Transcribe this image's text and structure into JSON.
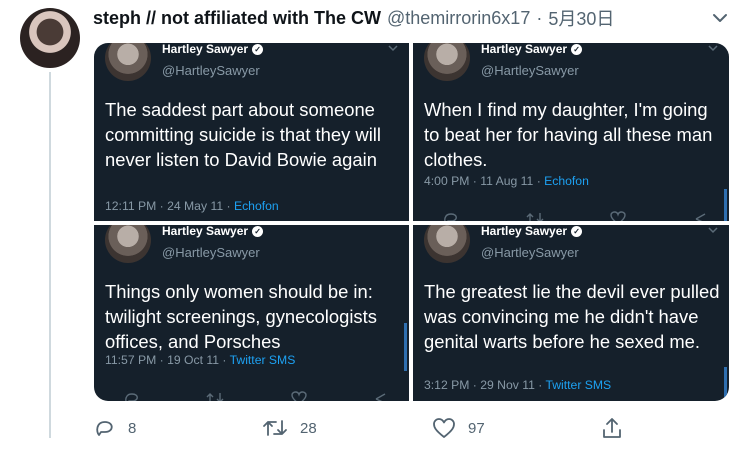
{
  "tweet": {
    "author_name": "steph // not affiliated with The CW",
    "author_handle": "@themirrorin6x17",
    "separator": "·",
    "date": "5月30日"
  },
  "embeds": [
    {
      "name": "Hartley Sawyer",
      "handle": "@HartleySawyer",
      "text": "The saddest part about someone committing suicide is that they will never listen to David Bowie again",
      "time": "12:11 PM · 24 May 11 · ",
      "source": "Echofon"
    },
    {
      "name": "Hartley Sawyer",
      "handle": "@HartleySawyer",
      "text": "When I find my daughter, I'm going to beat her for having all these man clothes.",
      "time": "4:00 PM · 11 Aug 11 · ",
      "source": "Echofon"
    },
    {
      "name": "Hartley Sawyer",
      "handle": "@HartleySawyer",
      "text": "Things only women should be in: twilight screenings, gynecologists offices, and Porsches",
      "time": "11:57 PM · 19 Oct 11 · ",
      "source": "Twitter SMS"
    },
    {
      "name": "Hartley Sawyer",
      "handle": "@HartleySawyer",
      "text": "The greatest lie the devil ever pulled was convincing me he didn't have genital warts before he sexed me.",
      "time": "3:12 PM · 29 Nov 11 · ",
      "source": "Twitter SMS"
    }
  ],
  "actions": {
    "reply_count": "8",
    "retweet_count": "28",
    "like_count": "97"
  },
  "icons": {
    "more": "chevron-down-icon",
    "verified": "verified-badge-icon",
    "reply": "reply-icon",
    "retweet": "retweet-icon",
    "like": "heart-icon",
    "share": "share-icon"
  }
}
